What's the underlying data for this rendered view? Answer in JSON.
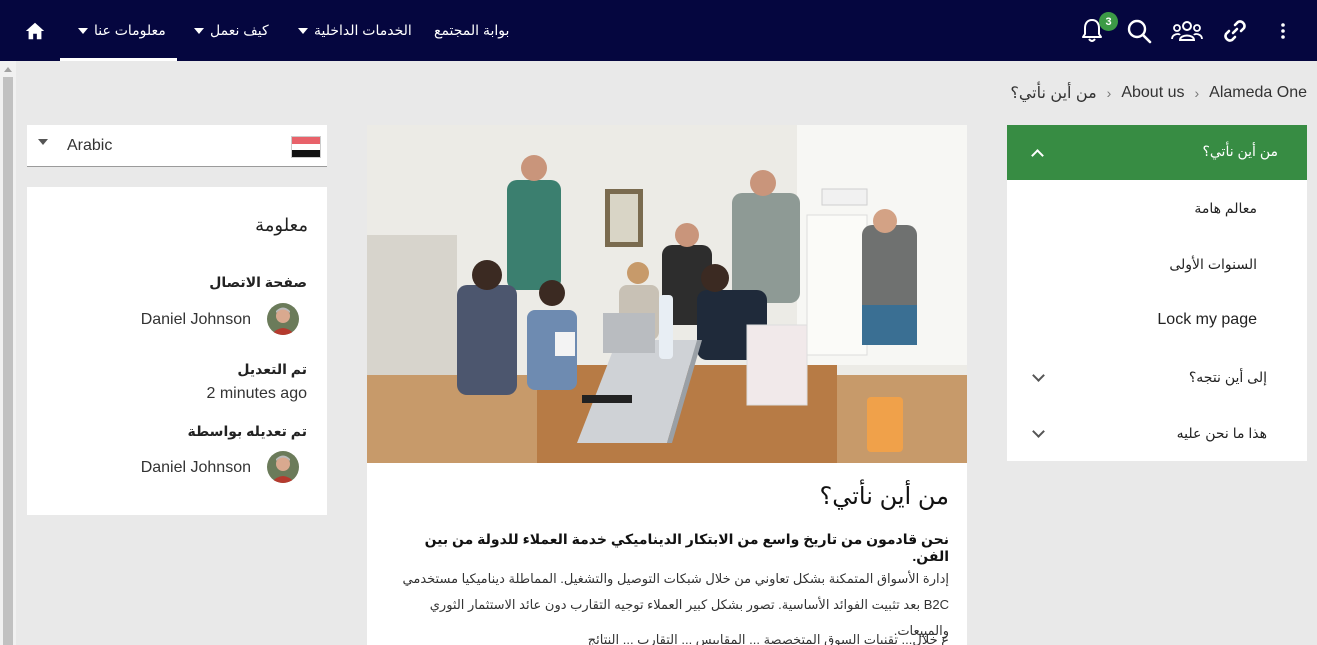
{
  "nav": {
    "items": [
      {
        "label": "معلومات عنا",
        "has_dropdown": true,
        "active": true
      },
      {
        "label": "كيف نعمل",
        "has_dropdown": true,
        "active": false
      },
      {
        "label": "الخدمات الداخلية",
        "has_dropdown": true,
        "active": false
      },
      {
        "label": "بوابة المجتمع",
        "has_dropdown": false,
        "active": false
      }
    ],
    "notification_count": "3",
    "icons": [
      "home-icon",
      "bell-icon",
      "search-icon",
      "users-icon",
      "link-icon",
      "more-vertical-icon"
    ]
  },
  "breadcrumb": [
    {
      "label": "Alameda One"
    },
    {
      "label": "About us"
    },
    {
      "label": "من أين نأتي؟"
    }
  ],
  "language": {
    "selected": "Arabic",
    "flag": "egypt-flag"
  },
  "info": {
    "heading": "معلومة",
    "contact_label": "صفحة الاتصال",
    "contact_name": "Daniel Johnson",
    "modified_label": "تم التعديل",
    "modified_value": "2 minutes ago",
    "modified_by_label": "تم تعديله بواسطة",
    "modified_by_name": "Daniel Johnson"
  },
  "article": {
    "title": "من أين نأتي؟",
    "lead": "نحن قادمون من تاريخ واسع من الابتكار الديناميكي خدمة العملاء للدولة من بين الفن.",
    "body": "إدارة الأسواق المتمكنة بشكل تعاوني من خلال شبكات التوصيل والتشغيل. المماطلة ديناميكيا مستخدمي B2C بعد تثبيت الفوائد الأساسية. تصور بشكل كبير العملاء توجيه التقارب دون عائد الاستثمار الثوري والمبيعات.",
    "body2": "ع خلال... تقنيات السوق المتخصصة ... المقاييس ... التقارب ... النتائج"
  },
  "sidebar": {
    "header": "من أين نأتي؟",
    "items": [
      {
        "label": "معالم هامة",
        "expandable": false
      },
      {
        "label": "السنوات الأولى",
        "expandable": false
      },
      {
        "label": "Lock my page",
        "expandable": false
      },
      {
        "label": "إلى أين نتجه؟",
        "expandable": true
      },
      {
        "label": "هذا ما نحن عليه",
        "expandable": true
      }
    ]
  },
  "colors": {
    "topbar": "#05063f",
    "accent_green": "#378c43",
    "badge_green": "#3c9a46",
    "background": "#e9e9e9"
  }
}
